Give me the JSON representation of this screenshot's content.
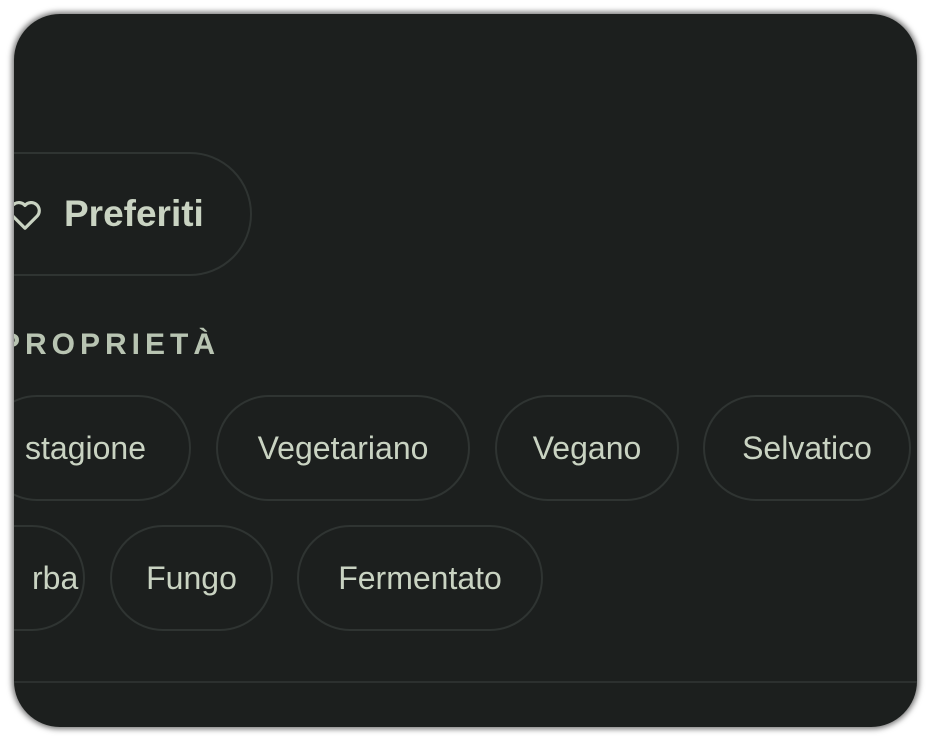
{
  "favorites": {
    "label": "Preferiti",
    "icon": "heart-outline-icon"
  },
  "section": {
    "title": "PROPRIETÀ"
  },
  "properties": {
    "row1": [
      "stagione",
      "Vegetariano",
      "Vegano",
      "Selvatico"
    ],
    "row2": [
      "rba",
      "Fungo",
      "Fermentato"
    ]
  },
  "colors": {
    "background": "#1c1f1e",
    "chip_border": "#2f3432",
    "text": "#c9d3c2"
  }
}
